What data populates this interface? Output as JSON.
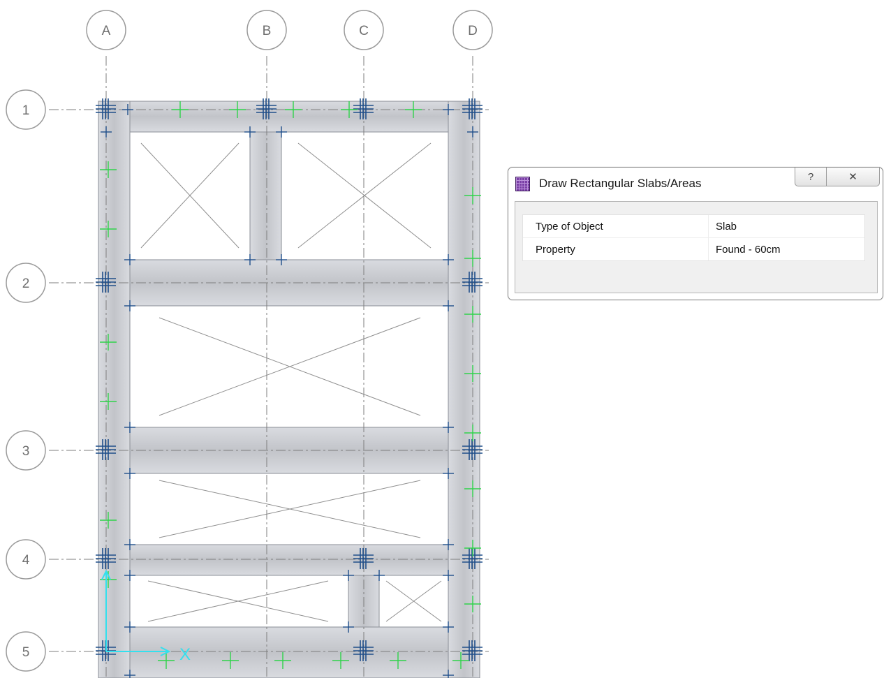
{
  "grid": {
    "columns": [
      "A",
      "B",
      "C",
      "D"
    ],
    "rows": [
      "1",
      "2",
      "3",
      "4",
      "5"
    ]
  },
  "axis_label": "X",
  "dialog": {
    "title": "Draw Rectangular Slabs/Areas",
    "icon": "slab-draw-icon",
    "help_symbol": "?",
    "close_symbol": "✕",
    "fields": [
      {
        "label": "Type of Object",
        "value": "Slab"
      },
      {
        "label": "Property",
        "value": "Found - 60cm"
      }
    ]
  },
  "colors": {
    "beam_fill": "#d3d5da",
    "beam_stroke": "#8a8e96",
    "grid_line": "#7e7e7e",
    "joint_blue": "#1f4e8a",
    "point_green": "#2fd34a",
    "axis_cyan": "#33e0ee"
  }
}
